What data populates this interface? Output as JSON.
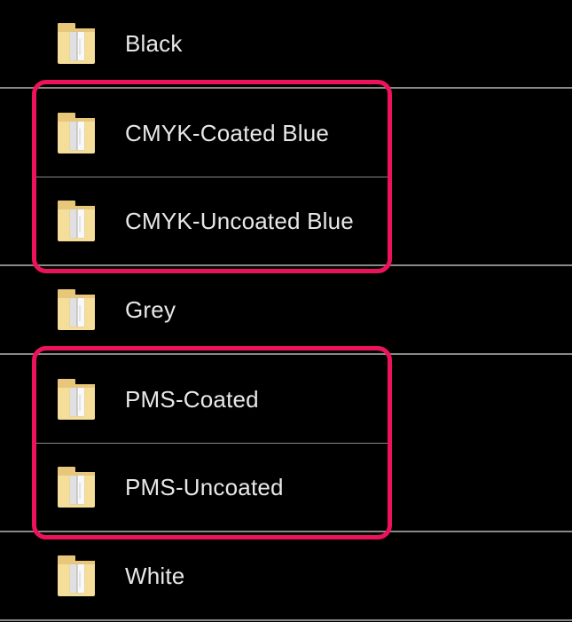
{
  "rows": [
    {
      "label": "Black"
    },
    {
      "label": "CMYK-Coated Blue"
    },
    {
      "label": "CMYK-Uncoated Blue"
    },
    {
      "label": "Grey"
    },
    {
      "label": "PMS-Coated"
    },
    {
      "label": "PMS-Uncoated"
    },
    {
      "label": "White"
    }
  ],
  "highlight_color": "#ed135a"
}
